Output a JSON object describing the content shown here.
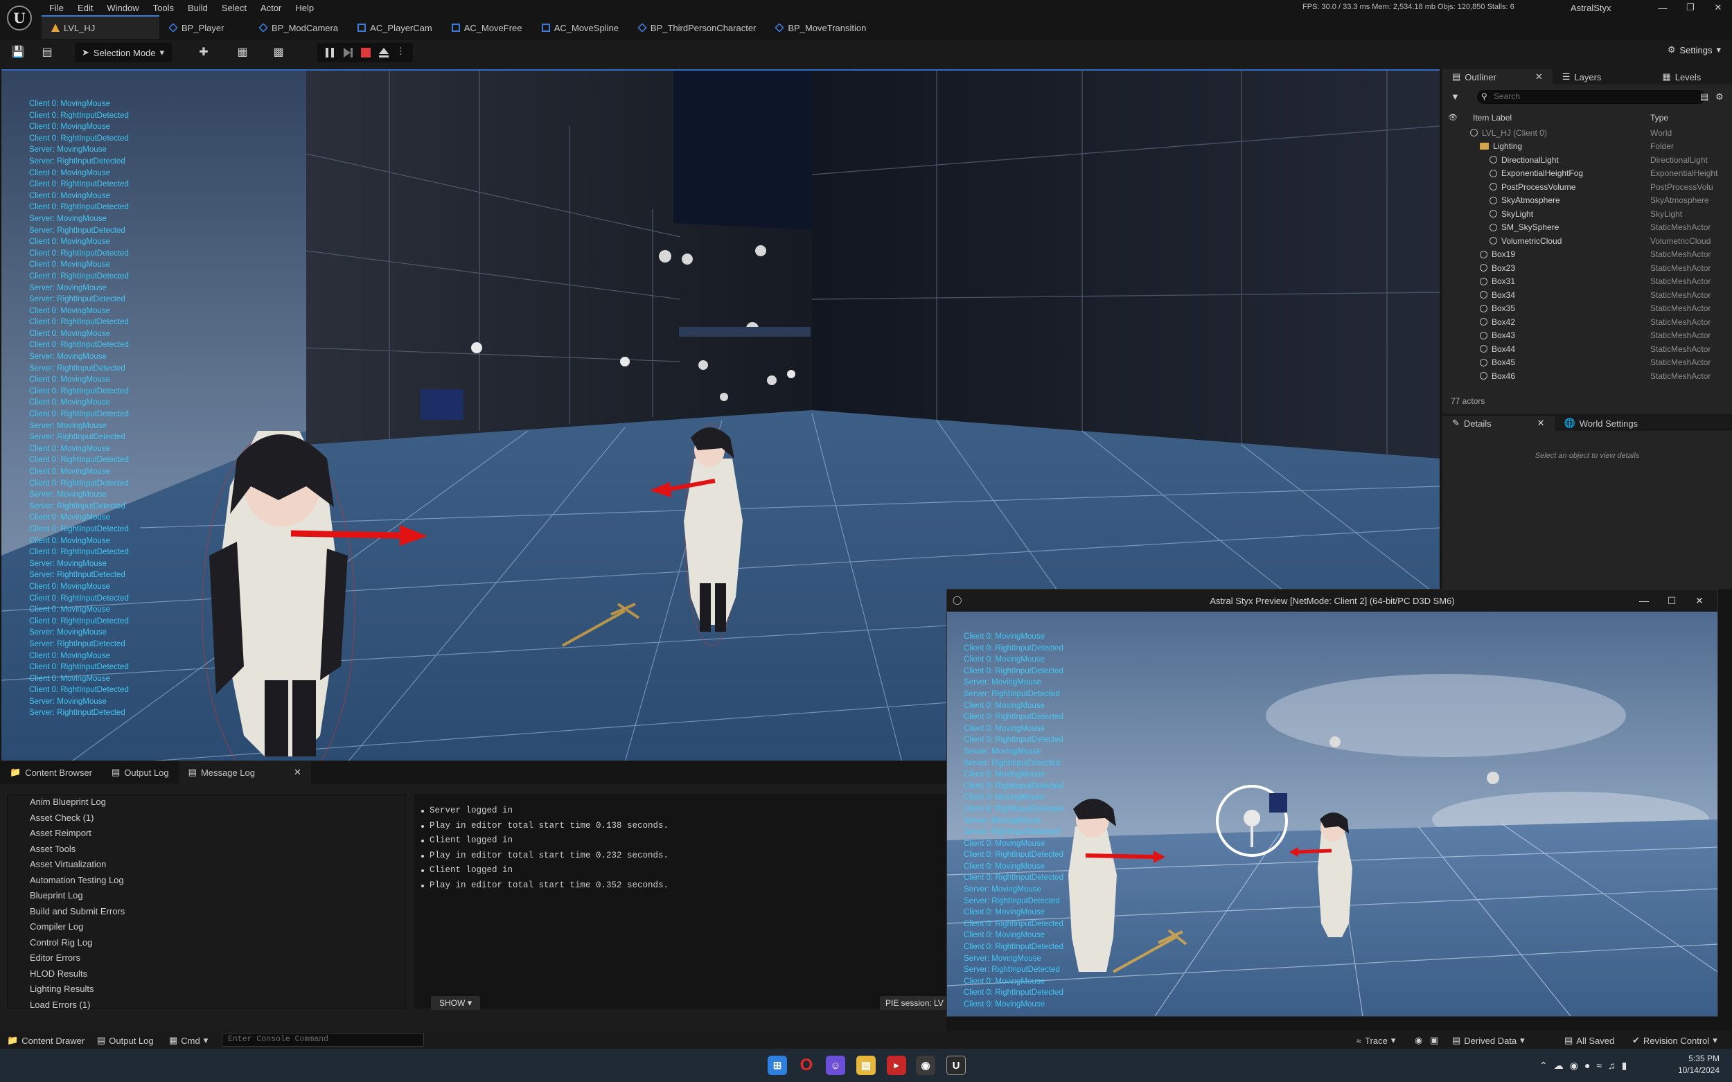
{
  "menubar": {
    "items": [
      "File",
      "Edit",
      "Window",
      "Tools",
      "Build",
      "Select",
      "Actor",
      "Help"
    ],
    "stats": "FPS: 30.0 / 33.3 ms  Mem: 2,534.18 mb  Objs: 120,850  Stalls: 6",
    "project_name": "AstralStyx"
  },
  "doc_tabs": [
    {
      "label": "LVL_HJ",
      "icon": "level-icon",
      "active": true
    },
    {
      "label": "BP_Player",
      "icon": "blueprint-icon"
    },
    {
      "label": "BP_ModCamera",
      "icon": "blueprint-icon"
    },
    {
      "label": "AC_PlayerCam",
      "icon": "component-icon"
    },
    {
      "label": "AC_MoveFree",
      "icon": "component-icon"
    },
    {
      "label": "AC_MoveSpline",
      "icon": "component-icon"
    },
    {
      "label": "BP_ThirdPersonCharacter",
      "icon": "blueprint-icon"
    },
    {
      "label": "BP_MoveTransition",
      "icon": "blueprint-icon"
    }
  ],
  "toolbar": {
    "selection_mode": "Selection Mode",
    "settings": "Settings"
  },
  "viewport_log": [
    "Client 0: MovingMouse",
    "Client 0: RightInputDetected",
    "Client 0: MovingMouse",
    "Client 0: RightInputDetected",
    "Server: MovingMouse",
    "Server: RightInputDetected",
    "Client 0: MovingMouse",
    "Client 0: RightInputDetected",
    "Client 0: MovingMouse",
    "Client 0: RightInputDetected",
    "Server: MovingMouse",
    "Server: RightInputDetected",
    "Client 0: MovingMouse",
    "Client 0: RightInputDetected",
    "Client 0: MovingMouse",
    "Client 0: RightInputDetected",
    "Server: MovingMouse",
    "Server: RightInputDetected",
    "Client 0: MovingMouse",
    "Client 0: RightInputDetected",
    "Client 0: MovingMouse",
    "Client 0: RightInputDetected",
    "Server: MovingMouse",
    "Server: RightInputDetected",
    "Client 0: MovingMouse",
    "Client 0: RightInputDetected",
    "Client 0: MovingMouse",
    "Client 0: RightInputDetected",
    "Server: MovingMouse",
    "Server: RightInputDetected",
    "Client 0: MovingMouse",
    "Client 0: RightInputDetected",
    "Client 0: MovingMouse",
    "Client 0: RightInputDetected",
    "Server: MovingMouse",
    "Server: RightInputDetected",
    "Client 0: MovingMouse",
    "Client 0: RightInputDetected",
    "Client 0: MovingMouse",
    "Client 0: RightInputDetected",
    "Server: MovingMouse",
    "Server: RightInputDetected",
    "Client 0: MovingMouse",
    "Client 0: RightInputDetected",
    "Client 0: MovingMouse",
    "Client 0: RightInputDetected",
    "Server: MovingMouse",
    "Server: RightInputDetected",
    "Client 0: MovingMouse",
    "Client 0: RightInputDetected",
    "Client 0: MovingMouse",
    "Client 0: RightInputDetected",
    "Server: MovingMouse",
    "Server: RightInputDetected"
  ],
  "outliner": {
    "tabs": [
      "Outliner",
      "Layers",
      "Levels"
    ],
    "search_placeholder": "Search",
    "col_label": "Item Label",
    "col_type": "Type",
    "rows": [
      {
        "label": "LVL_HJ (Client 0)",
        "type": "World",
        "depth": 0,
        "kind": "world"
      },
      {
        "label": "Lighting",
        "type": "Folder",
        "depth": 1,
        "kind": "folder"
      },
      {
        "label": "DirectionalLight",
        "type": "DirectionalLight",
        "depth": 2,
        "kind": "actor"
      },
      {
        "label": "ExponentialHeightFog",
        "type": "ExponentialHeight",
        "depth": 2,
        "kind": "actor"
      },
      {
        "label": "PostProcessVolume",
        "type": "PostProcessVolu",
        "depth": 2,
        "kind": "actor"
      },
      {
        "label": "SkyAtmosphere",
        "type": "SkyAtmosphere",
        "depth": 2,
        "kind": "actor"
      },
      {
        "label": "SkyLight",
        "type": "SkyLight",
        "depth": 2,
        "kind": "actor"
      },
      {
        "label": "SM_SkySphere",
        "type": "StaticMeshActor",
        "depth": 2,
        "kind": "actor"
      },
      {
        "label": "VolumetricCloud",
        "type": "VolumetricCloud",
        "depth": 2,
        "kind": "actor"
      },
      {
        "label": "Box19",
        "type": "StaticMeshActor",
        "depth": 1,
        "kind": "actor"
      },
      {
        "label": "Box23",
        "type": "StaticMeshActor",
        "depth": 1,
        "kind": "actor"
      },
      {
        "label": "Box31",
        "type": "StaticMeshActor",
        "depth": 1,
        "kind": "actor"
      },
      {
        "label": "Box34",
        "type": "StaticMeshActor",
        "depth": 1,
        "kind": "actor"
      },
      {
        "label": "Box35",
        "type": "StaticMeshActor",
        "depth": 1,
        "kind": "actor"
      },
      {
        "label": "Box42",
        "type": "StaticMeshActor",
        "depth": 1,
        "kind": "actor"
      },
      {
        "label": "Box43",
        "type": "StaticMeshActor",
        "depth": 1,
        "kind": "actor"
      },
      {
        "label": "Box44",
        "type": "StaticMeshActor",
        "depth": 1,
        "kind": "actor"
      },
      {
        "label": "Box45",
        "type": "StaticMeshActor",
        "depth": 1,
        "kind": "actor"
      },
      {
        "label": "Box46",
        "type": "StaticMeshActor",
        "depth": 1,
        "kind": "actor"
      }
    ],
    "count": "77 actors"
  },
  "details": {
    "tabs": [
      "Details",
      "World Settings"
    ],
    "empty_text": "Select an object to view details"
  },
  "bottom_panel": {
    "tabs": [
      "Content Browser",
      "Output Log",
      "Message Log"
    ],
    "categories": [
      "Anim Blueprint Log",
      "Asset Check (1)",
      "Asset Reimport",
      "Asset Tools",
      "Asset Virtualization",
      "Automation Testing Log",
      "Blueprint Log",
      "Build and Submit Errors",
      "Compiler Log",
      "Control Rig Log",
      "Editor Errors",
      "HLOD Results",
      "Lighting Results",
      "Load Errors (1)"
    ],
    "messages": [
      "Server logged in",
      "Play in editor total start time 0.138 seconds.",
      "Client logged in",
      "Play in editor total start time 0.232 seconds.",
      "Client logged in",
      "Play in editor total start time 0.352 seconds."
    ],
    "show_label": "SHOW",
    "pie_label": "PIE session: LV"
  },
  "preview": {
    "title": "Astral Styx Preview [NetMode: Client 2]  (64-bit/PC D3D SM6)",
    "log": [
      "Client 0: MovingMouse",
      "Client 0: RightInputDetected",
      "Client 0: MovingMouse",
      "Client 0: RightInputDetected",
      "Server: MovingMouse",
      "Server: RightInputDetected",
      "Client 0: MovingMouse",
      "Client 0: RightInputDetected",
      "Client 0: MovingMouse",
      "Client 0: RightInputDetected",
      "Server: MovingMouse",
      "Server: RightInputDetected",
      "Client 0: MovingMouse",
      "Client 0: RightInputDetected",
      "Client 0: MovingMouse",
      "Client 0: RightInputDetected",
      "Server: MovingMouse",
      "Server: RightInputDetected",
      "Client 0: MovingMouse",
      "Client 0: RightInputDetected",
      "Client 0: MovingMouse",
      "Client 0: RightInputDetected",
      "Server: MovingMouse",
      "Server: RightInputDetected",
      "Client 0: MovingMouse",
      "Client 0: RightInputDetected",
      "Client 0: MovingMouse",
      "Client 0: RightInputDetected",
      "Server: MovingMouse",
      "Server: RightInputDetected",
      "Client 0: MovingMouse",
      "Client 0: RightInputDetected",
      "Client 0: MovingMouse"
    ]
  },
  "statusbar": {
    "content_drawer": "Content Drawer",
    "output_log": "Output Log",
    "cmd": "Cmd",
    "console_placeholder": "Enter Console Command",
    "trace": "Trace",
    "derived_data": "Derived Data",
    "all_saved": "All Saved",
    "revision_control": "Revision Control"
  },
  "taskbar": {
    "time": "5:35 PM",
    "date": "10/14/2024"
  },
  "colors": {
    "accent": "#2e6cc6",
    "log_text": "#42c7f4",
    "arrow_red": "#e21212"
  }
}
